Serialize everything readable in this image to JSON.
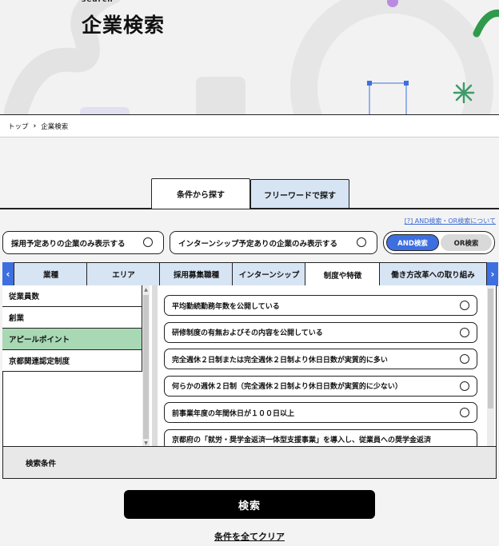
{
  "hero": {
    "kicker": "search",
    "title": "企業検索"
  },
  "breadcrumb": {
    "home": "トップ",
    "current": "企業検索"
  },
  "main_tabs": [
    {
      "label": "条件から探す",
      "active": true
    },
    {
      "label": "フリーワードで探す",
      "active": false
    }
  ],
  "help_link": "[?] AND検索・OR検索について",
  "filters": {
    "hiring_label": "採用予定ありの企業のみ表示する",
    "internship_label": "インターンシップ予定ありの企業のみ表示する",
    "and_label": "AND検索",
    "or_label": "OR検索"
  },
  "category_tabs": [
    {
      "label": "業種"
    },
    {
      "label": "エリア"
    },
    {
      "label": "採用募集職種"
    },
    {
      "label": "インターンシップ"
    },
    {
      "label": "制度や特徴"
    },
    {
      "label": "働き方改革への取り組み"
    }
  ],
  "left_items": [
    {
      "label": "従業員数"
    },
    {
      "label": "創業"
    },
    {
      "label": "アピールポイント"
    },
    {
      "label": "京都関連認定制度"
    }
  ],
  "right_items": [
    {
      "label": "平均勤続勤務年数を公開している"
    },
    {
      "label": "研修制度の有無およびその内容を公開している"
    },
    {
      "label": "完全週休２日制または完全週休２日制より休日日数が実質的に多い"
    },
    {
      "label": "何らかの週休２日制（完全週休２日制より休日日数が実質的に少ない）"
    },
    {
      "label": "前事業年度の年間休日が１００日以上"
    },
    {
      "label": "京都府の「就労・奨学金返済一体型支援事業」を導入し、従業員への奨学金返済"
    }
  ],
  "conditions_label": "検索条件",
  "search_button": "検索",
  "clear_link": "条件を全てクリア",
  "colors": {
    "accent_blue": "#3d6fe0",
    "tab_blue": "#d6e4f4",
    "selected_green": "#a8d8b4",
    "deco_green": "#2f9a4c"
  }
}
